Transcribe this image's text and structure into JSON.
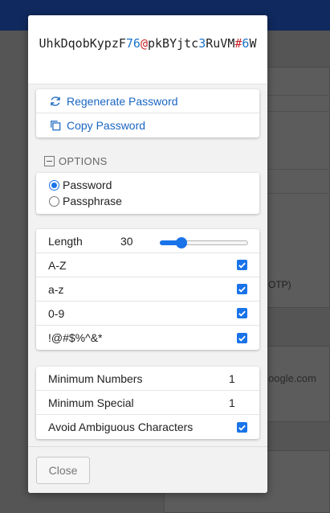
{
  "password": {
    "segments": [
      {
        "text": "UhkDqobKypzF",
        "kind": "char"
      },
      {
        "text": "76",
        "kind": "num"
      },
      {
        "text": "@",
        "kind": "sym"
      },
      {
        "text": "pkBYjtc",
        "kind": "char"
      },
      {
        "text": "3",
        "kind": "num"
      },
      {
        "text": "RuVM",
        "kind": "char"
      },
      {
        "text": "#",
        "kind": "sym"
      },
      {
        "text": "6",
        "kind": "num"
      },
      {
        "text": "W",
        "kind": "char"
      }
    ]
  },
  "actions": {
    "regenerate_label": "Regenerate Password",
    "copy_label": "Copy Password"
  },
  "options": {
    "section_label": "OPTIONS",
    "type_options": [
      {
        "label": "Password",
        "selected": true
      },
      {
        "label": "Passphrase",
        "selected": false
      }
    ],
    "length": {
      "label": "Length",
      "value": "30",
      "min": 5,
      "max": 128,
      "current": 30
    },
    "charsets": [
      {
        "label": "A-Z",
        "checked": true
      },
      {
        "label": "a-z",
        "checked": true
      },
      {
        "label": "0-9",
        "checked": true
      },
      {
        "label": "!@#$%^&*",
        "checked": true
      }
    ],
    "minimum_numbers": {
      "label": "Minimum Numbers",
      "value": "1"
    },
    "minimum_special": {
      "label": "Minimum Special",
      "value": "1"
    },
    "avoid_ambiguous": {
      "label": "Avoid Ambiguous Characters",
      "checked": true
    }
  },
  "footer": {
    "close_label": "Close"
  },
  "background": {
    "text_otp": "OTP)",
    "text_domain": "oogle.com"
  },
  "colors": {
    "accent": "#1a73e8",
    "link": "#1a66c2",
    "password_number": "#1a73c8",
    "password_symbol": "#c9252c",
    "header": "#10295e"
  },
  "icons": {
    "regenerate": "refresh-icon",
    "copy": "copy-icon",
    "collapse": "minus-square-icon",
    "checkbox": "check-icon"
  }
}
